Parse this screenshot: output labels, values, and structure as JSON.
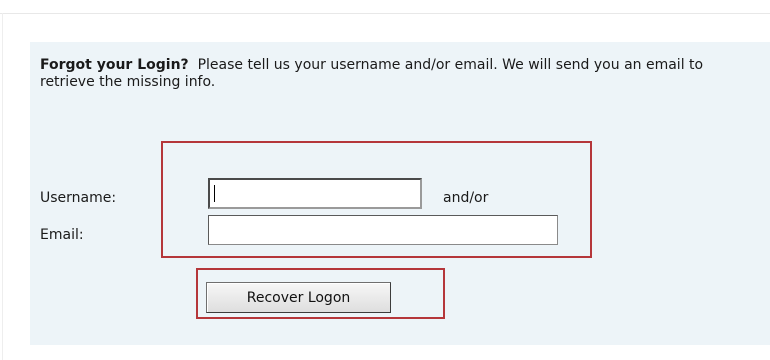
{
  "intro": {
    "heading": "Forgot your Login?",
    "message": "Please tell us your username and/or email. We will send you an email to retrieve the missing info."
  },
  "form": {
    "username_label": "Username:",
    "username_value": "",
    "and_or": "and/or",
    "email_label": "Email:",
    "email_value": "",
    "submit_label": "Recover Logon"
  },
  "colors": {
    "panel_background": "#edf4f8",
    "highlight_border": "#b5363a"
  }
}
